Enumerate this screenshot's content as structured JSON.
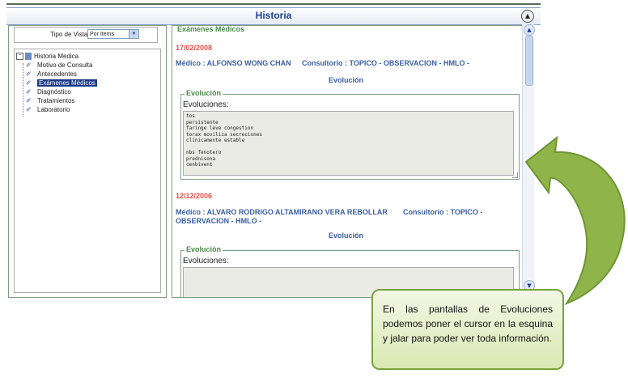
{
  "window": {
    "title": "Historia"
  },
  "view": {
    "label": "Tipo de Vista:",
    "selected": "Por Items"
  },
  "tree": {
    "root": "Historia Medica",
    "items": [
      {
        "label": "Motivo de Consulta"
      },
      {
        "label": "Antecedentes"
      },
      {
        "label": "Exámenes Médicos",
        "selected": true
      },
      {
        "label": "Diagnóstico"
      },
      {
        "label": "Tratamientos"
      },
      {
        "label": "Laboratorio"
      }
    ]
  },
  "section": {
    "title": "Exámenes Médicos"
  },
  "records": [
    {
      "date": "17/02/2008",
      "doctor": "Médico : ALFONSO WONG CHAN",
      "consultorio": "Consultorio : TOPICO - OBSERVACION - HMLO -",
      "evo_heading": "Evolución",
      "box_legend": "Evolución",
      "box_label": "Evoluciones:",
      "notes": "tos\npersistente\nfaringe leve congestion\ntorax moviliza secreciones\nclinicamente estable\n\nnbs fenotero\nprednisona\ncenbivent"
    },
    {
      "date": "12/12/2006",
      "doctor": "Médico : ALVARO RODRIGO ALTAMIRANO VERA REBOLLAR",
      "consultorio": "Consultorio : TOPICO -",
      "doctor_cont": "OBSERVACION - HMLO -",
      "evo_heading": "Evolución",
      "box_legend": "Evolución",
      "box_label": "Evoluciones:",
      "notes": ""
    }
  ],
  "callout": {
    "text": "En las pantallas de Evoluciones podemos poner el cursor en la esquina y jalar para poder ver toda información",
    "dot": ".",
    "color": "#7aa23c"
  }
}
